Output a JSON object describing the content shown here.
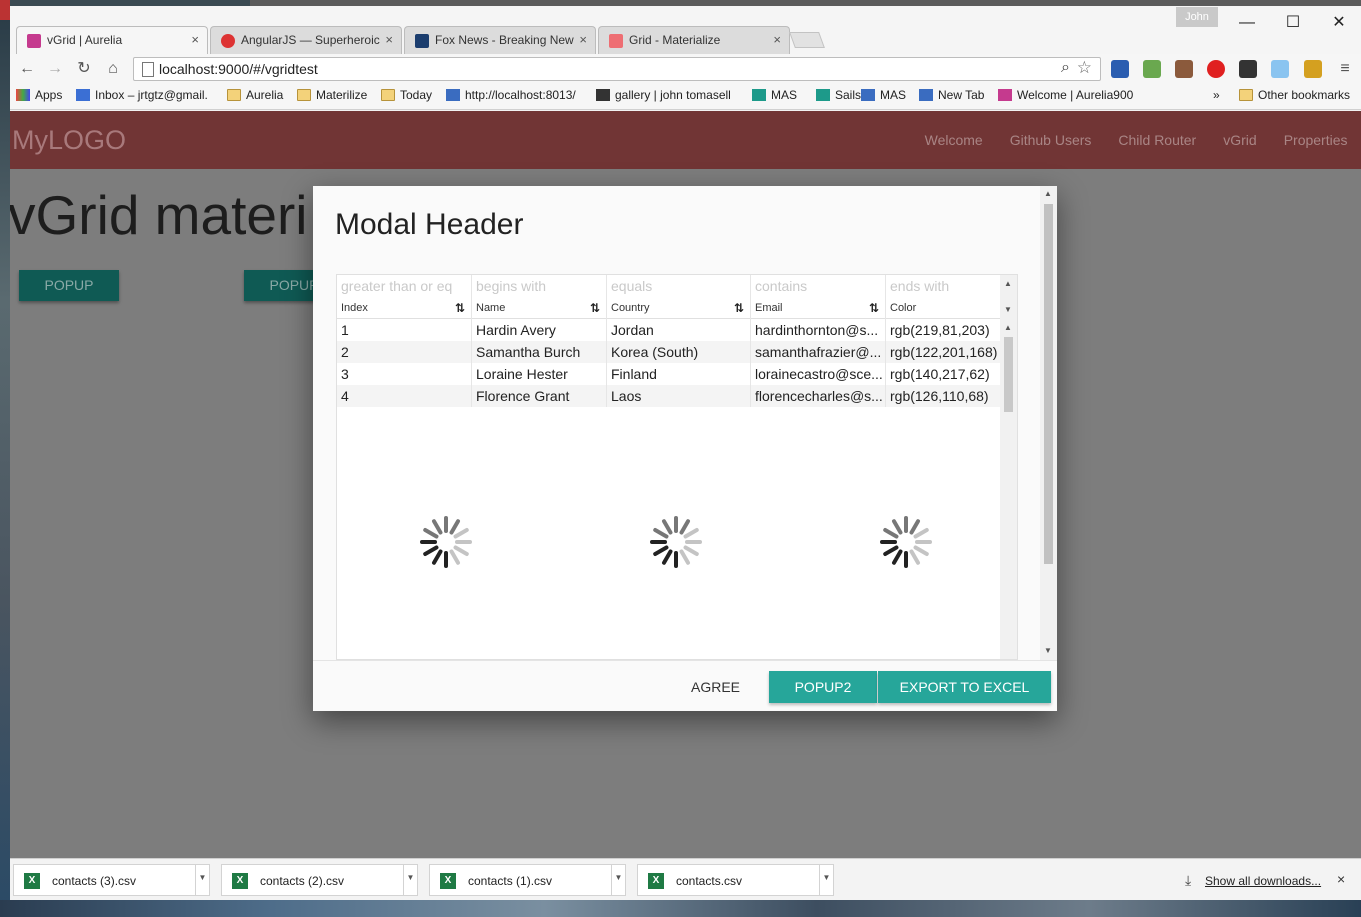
{
  "browser": {
    "profile": "John",
    "tabs": [
      {
        "title": "vGrid | Aurelia",
        "close": "×",
        "color": "#c53a8e"
      },
      {
        "title": "AngularJS — Superheroic",
        "close": "×",
        "color": "#dd3333"
      },
      {
        "title": "Fox News - Breaking New",
        "close": "×",
        "color": "#1b3d6e"
      },
      {
        "title": "Grid - Materialize",
        "close": "×",
        "color": "#ee6e73"
      }
    ],
    "url": "localhost:9000/#/vgridtest",
    "bookmarks": [
      "Apps",
      "Inbox – jrtgtz@gmail.",
      "Aurelia",
      "Materilize",
      "Today",
      "http://localhost:8013/",
      "gallery | john tomasell",
      "MAS",
      "Sails",
      "MAS",
      "New Tab",
      "Welcome | Aurelia900",
      "»",
      "Other bookmarks"
    ]
  },
  "page": {
    "logo": "MyLOGO",
    "nav": [
      "Welcome",
      "Github Users",
      "Child Router",
      "vGrid",
      "Properties"
    ],
    "title": "vGrid materi",
    "buttons": [
      "POPUP",
      "POPUP"
    ]
  },
  "modal": {
    "header": "Modal Header",
    "filters": [
      "greater than or eq",
      "begins with",
      "equals",
      "contains",
      "ends with"
    ],
    "columns": [
      "Index",
      "Name",
      "Country",
      "Email",
      "Color"
    ],
    "sort_glyph": "⇅",
    "rows": [
      [
        "1",
        "Hardin Avery",
        "Jordan",
        "hardinthornton@s...",
        "rgb(219,81,203)"
      ],
      [
        "2",
        "Samantha Burch",
        "Korea (South)",
        "samanthafrazier@...",
        "rgb(122,201,168)"
      ],
      [
        "3",
        "Loraine Hester",
        "Finland",
        "lorainecastro@sce...",
        "rgb(140,217,62)"
      ],
      [
        "4",
        "Florence Grant",
        "Laos",
        "florencecharles@s...",
        "rgb(126,110,68)"
      ]
    ],
    "footer": {
      "agree": "AGREE",
      "popup2": "POPUP2",
      "export": "EXPORT TO EXCEL"
    }
  },
  "downloads": {
    "items": [
      "contacts (3).csv",
      "contacts (2).csv",
      "contacts (1).csv",
      "contacts.csv"
    ],
    "show_all": "Show all downloads...",
    "close": "×"
  },
  "colors": {
    "navbar": "#713535",
    "accent": "#26a69a",
    "overlay": "#7d7d7d"
  }
}
